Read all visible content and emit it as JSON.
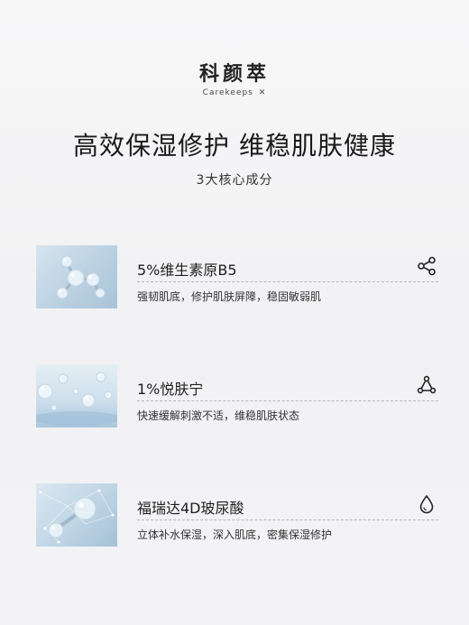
{
  "brand": {
    "name_cn": "科颜萃",
    "name_en": "Carekeeps",
    "mark": "✕"
  },
  "headline": "高效保湿修护 维稳肌肤健康",
  "subhead": "3大核心成分",
  "ingredients": [
    {
      "title": "5%维生素原B5",
      "desc": "强韧肌底，修护肌肤屏障，稳固敏弱肌",
      "icon": "molecule-share-icon"
    },
    {
      "title": "1%悦肤宁",
      "desc": "快速缓解刺激不适，维稳肌肤状态",
      "icon": "triangle-nodes-icon"
    },
    {
      "title": "福瑞达4D玻尿酸",
      "desc": "立体补水保湿，深入肌底，密集保湿修护",
      "icon": "water-drop-icon"
    }
  ],
  "colors": {
    "thumb_blue": "#b8cfe0",
    "text": "#1f1f1f",
    "divider": "#b8b8b8"
  }
}
